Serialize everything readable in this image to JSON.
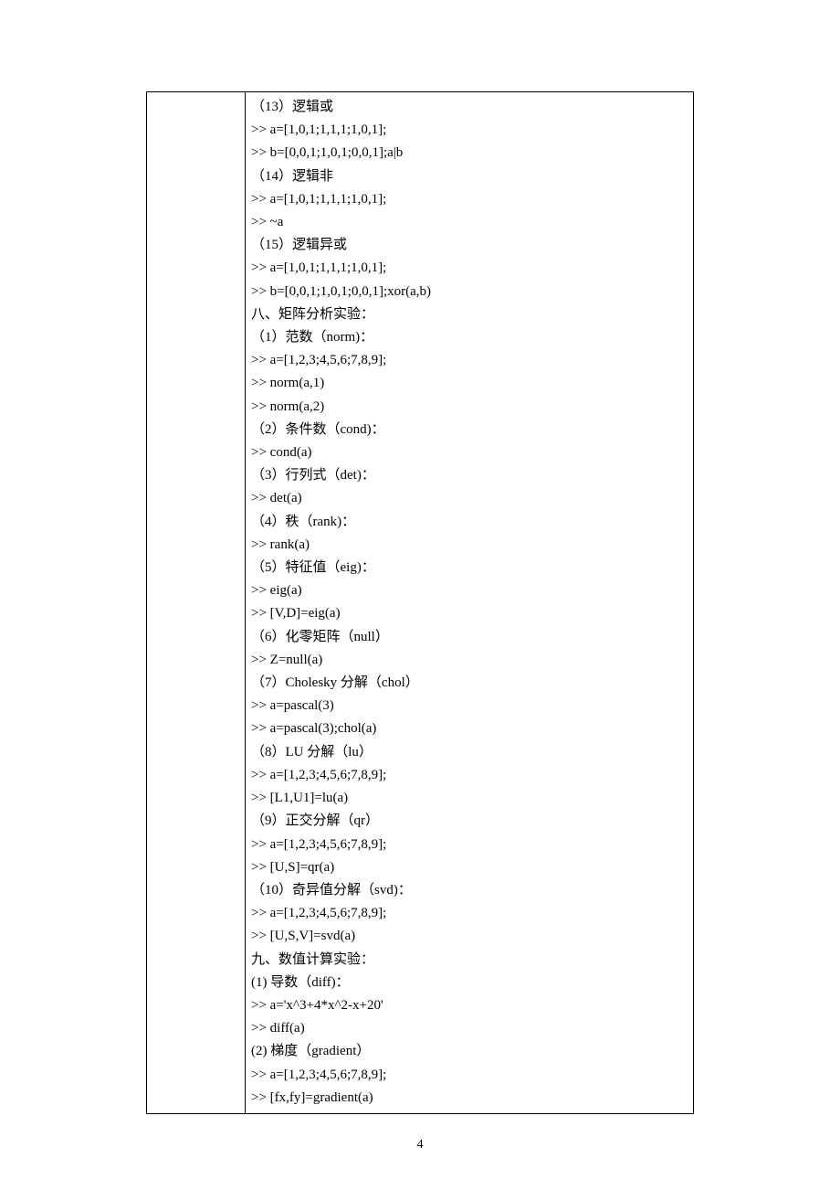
{
  "lines": [
    "（13）逻辑或",
    ">> a=[1,0,1;1,1,1;1,0,1];",
    ">> b=[0,0,1;1,0,1;0,0,1];a|b",
    "（14）逻辑非",
    ">> a=[1,0,1;1,1,1;1,0,1];",
    ">> ~a",
    "（15）逻辑异或",
    ">> a=[1,0,1;1,1,1;1,0,1];",
    ">> b=[0,0,1;1,0,1;0,0,1];xor(a,b)",
    "八、矩阵分析实验：",
    "（1）范数（norm)：",
    ">> a=[1,2,3;4,5,6;7,8,9];",
    ">> norm(a,1)",
    ">> norm(a,2)",
    "（2）条件数（cond)：",
    ">> cond(a)",
    "（3）行列式（det)：",
    ">> det(a)",
    "（4）秩（rank)：",
    ">> rank(a)",
    "（5）特征值（eig)：",
    ">> eig(a)",
    ">> [V,D]=eig(a)",
    "（6）化零矩阵（null）",
    ">> Z=null(a)",
    "（7）Cholesky 分解（chol）",
    ">> a=pascal(3)",
    ">> a=pascal(3);chol(a)",
    "（8）LU 分解（lu）",
    ">> a=[1,2,3;4,5,6;7,8,9];",
    ">> [L1,U1]=lu(a)",
    "（9）正交分解（qr）",
    ">> a=[1,2,3;4,5,6;7,8,9];",
    ">> [U,S]=qr(a)",
    "（10）奇异值分解（svd)：",
    ">> a=[1,2,3;4,5,6;7,8,9];",
    ">> [U,S,V]=svd(a)",
    "九、数值计算实验：",
    "(1) 导数（diff)：",
    ">> a='x^3+4*x^2-x+20'",
    ">> diff(a)",
    "(2) 梯度（gradient）",
    ">> a=[1,2,3;4,5,6;7,8,9];",
    ">> [fx,fy]=gradient(a)"
  ],
  "page_number": "4"
}
